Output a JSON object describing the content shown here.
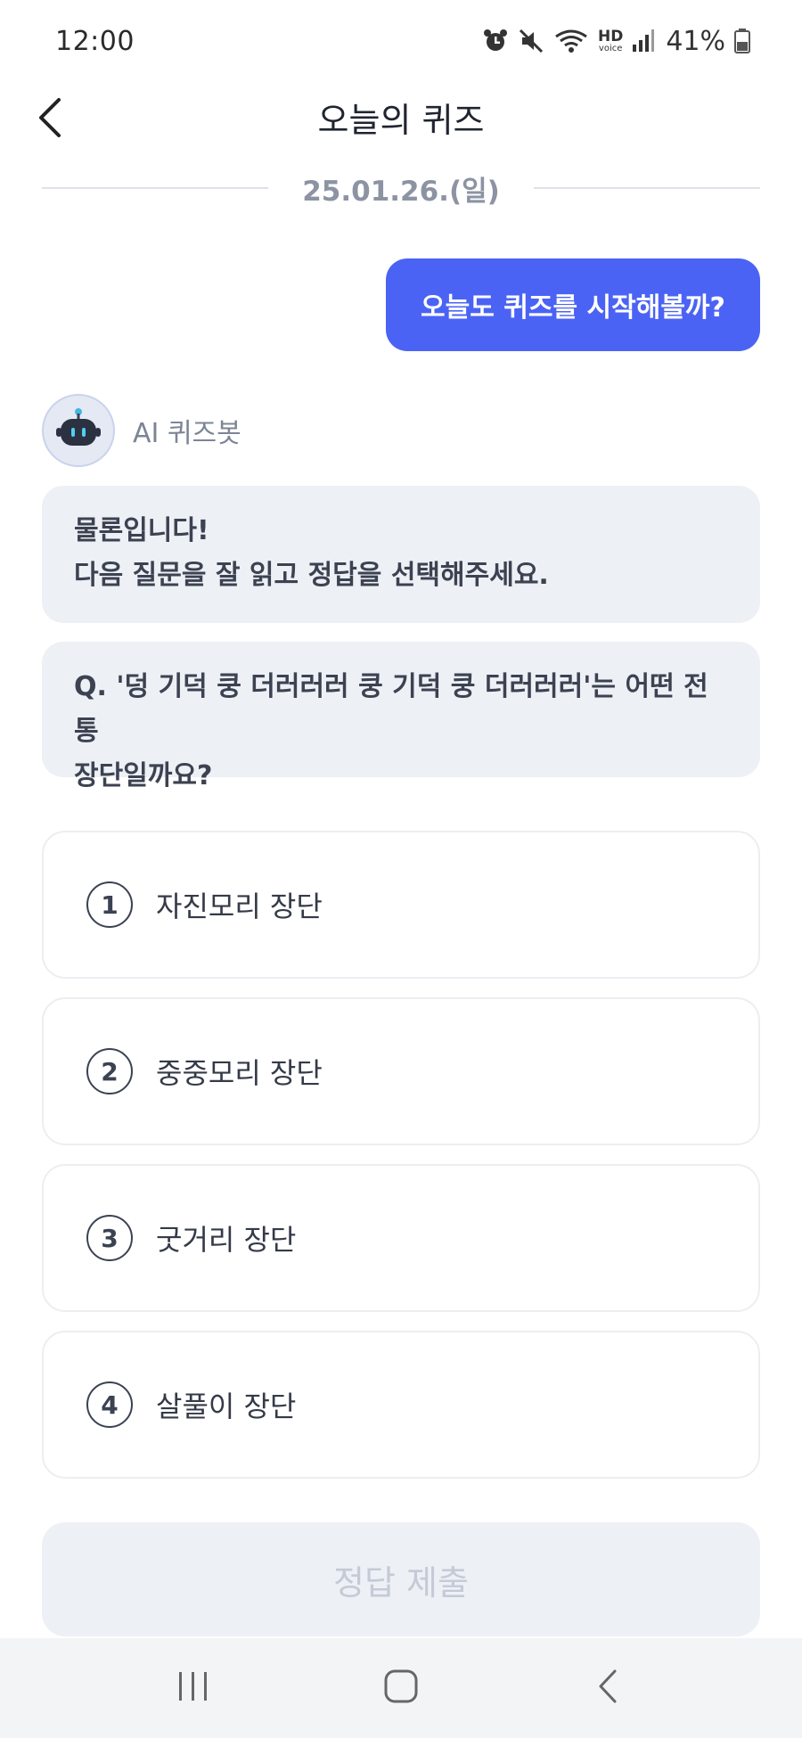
{
  "status_bar": {
    "time": "12:00",
    "battery_percent": "41%",
    "icons": [
      "alarm-icon",
      "mute-icon",
      "wifi-icon",
      "hd-voice-icon",
      "signal-icon",
      "battery-icon"
    ],
    "hd_voice_label": "HD",
    "hd_voice_sub": "voice"
  },
  "header": {
    "title": "오늘의 퀴즈",
    "back_icon": "chevron-left-icon"
  },
  "date_divider": {
    "label": "25.01.26.(일)"
  },
  "chat": {
    "user_message": "오늘도 퀴즈를 시작해볼까?",
    "bot_name": "AI 퀴즈봇",
    "bot_message_line1": "물론입니다!",
    "bot_message_line2": "다음 질문을 잘 읽고 정답을 선택해주세요.",
    "question_line1": "Q. '덩 기덕 쿵 더러러러 쿵 기덕 쿵 더러러러'는 어떤 전통",
    "question_line2": "장단일까요?"
  },
  "options": [
    {
      "number": "1",
      "label": "자진모리 장단"
    },
    {
      "number": "2",
      "label": "중중모리 장단"
    },
    {
      "number": "3",
      "label": "굿거리 장단"
    },
    {
      "number": "4",
      "label": "살풀이 장단"
    }
  ],
  "submit": {
    "label": "정답 제출",
    "enabled": false
  },
  "nav_bar": {
    "icons": [
      "recent-apps-icon",
      "home-icon",
      "back-icon"
    ]
  },
  "colors": {
    "accent": "#4b63f4",
    "bubble_bg": "#edf0f5",
    "disabled_text": "#c4cad6"
  }
}
